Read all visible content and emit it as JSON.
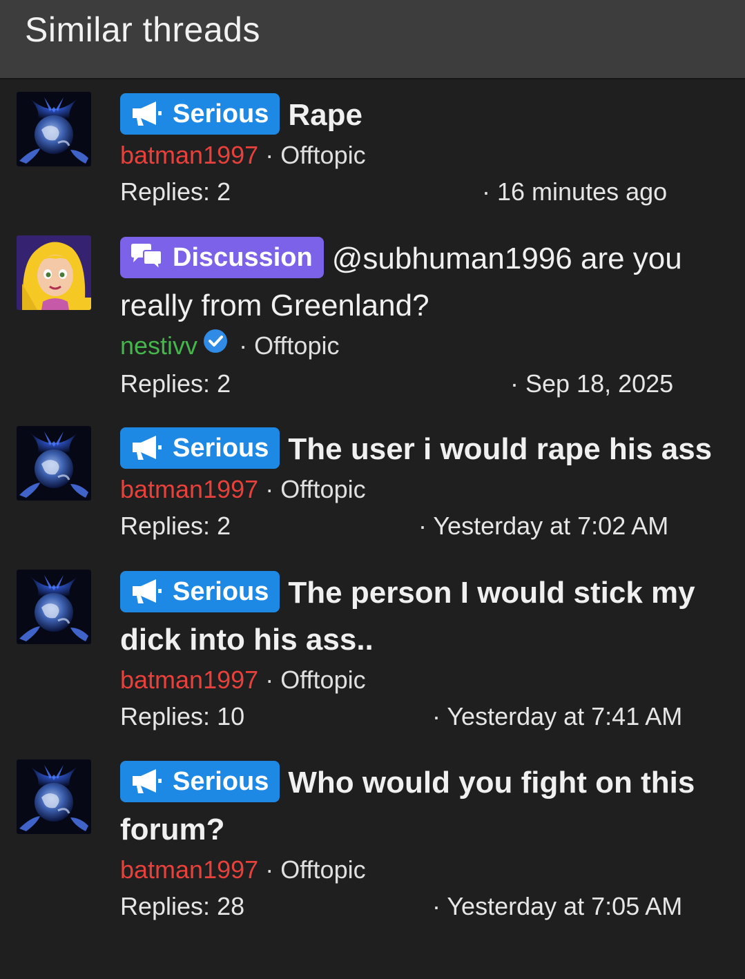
{
  "header": {
    "title": "Similar threads"
  },
  "threads": [
    {
      "avatar": "earth-avatar",
      "prefix": "Serious",
      "prefix_icon": "megaphone-icon",
      "title": "Rape",
      "author": "batman1997",
      "author_color": "#e8413b",
      "separator": "·",
      "forum": "Offtopic",
      "replies": "Replies: 2",
      "date": "· 16 minutes ago"
    },
    {
      "avatar": "princess-avatar",
      "prefix": "Discussion",
      "prefix_icon": "chat-bubbles-icon",
      "title": "@subhuman1996 are you really from Greenland?",
      "author": "nestivv",
      "author_color": "#44b64c",
      "verified": true,
      "separator": "·",
      "forum": "Offtopic",
      "replies": "Replies: 2",
      "date": "· Sep 18, 2025"
    },
    {
      "avatar": "earth-avatar",
      "prefix": "Serious",
      "prefix_icon": "megaphone-icon",
      "title": "The user i would rape his ass",
      "author": "batman1997",
      "author_color": "#e8413b",
      "separator": "·",
      "forum": "Offtopic",
      "replies": "Replies: 2",
      "date": "· Yesterday at 7:02 AM"
    },
    {
      "avatar": "earth-avatar",
      "prefix": "Serious",
      "prefix_icon": "megaphone-icon",
      "title": "The person I would stick my dick into his ass..",
      "author": "batman1997",
      "author_color": "#e8413b",
      "separator": "·",
      "forum": "Offtopic",
      "replies": "Replies: 10",
      "date": "· Yesterday at 7:41 AM"
    },
    {
      "avatar": "earth-avatar",
      "prefix": "Serious",
      "prefix_icon": "megaphone-icon",
      "title": "Who would you fight on this forum?",
      "author": "batman1997",
      "author_color": "#e8413b",
      "separator": "·",
      "forum": "Offtopic",
      "replies": "Replies: 28",
      "date": "· Yesterday at 7:05 AM"
    }
  ],
  "colors": {
    "serious_badge": "#1e88e5",
    "discussion_badge": "#7b62e8",
    "verified": "#2f8be6"
  }
}
